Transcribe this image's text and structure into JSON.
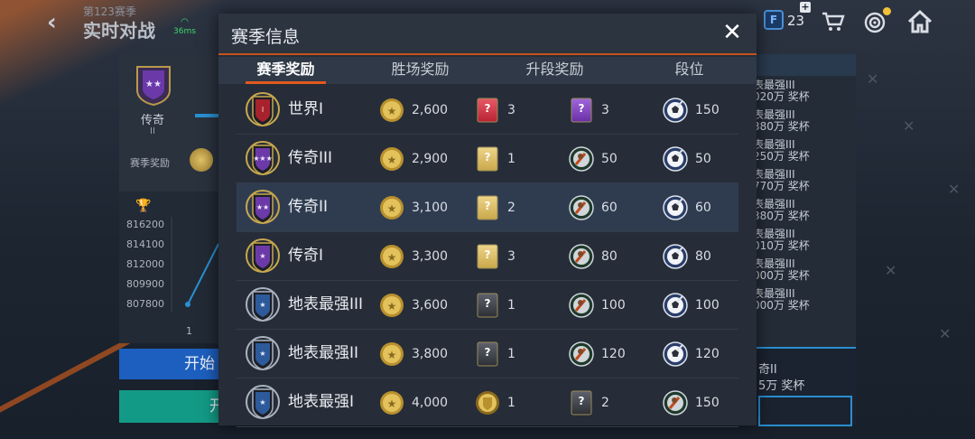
{
  "background": {
    "season_label": "第123赛季",
    "mode_title": "实时对战",
    "ping": "36ms",
    "fc_points": "23",
    "left_panel": {
      "rank_name": "传奇",
      "rank_sub": "II",
      "season_reward_label": "赛季奖励"
    },
    "graph": {
      "y_ticks": [
        "816200",
        "814100",
        "812000",
        "809900",
        "807800"
      ],
      "x_tick": "1"
    },
    "start_button_1": "开始",
    "start_button_2": "开",
    "right_panel": {
      "rows": [
        {
          "l1": "表最强III",
          "l2": "020万 奖杯"
        },
        {
          "l1": "表最强III",
          "l2": "380万 奖杯"
        },
        {
          "l1": "表最强III",
          "l2": "250万 奖杯"
        },
        {
          "l1": "表最强III",
          "l2": "770万 奖杯"
        },
        {
          "l1": "表最强III",
          "l2": "380万 奖杯"
        },
        {
          "l1": "表最强III",
          "l2": "010万 奖杯"
        },
        {
          "l1": "表最强III",
          "l2": "000万 奖杯"
        },
        {
          "l1": "表最强III",
          "l2": "000万 奖杯"
        }
      ],
      "bottom_line1": "奇II",
      "bottom_line2": "5万 奖杯"
    }
  },
  "modal": {
    "title": "赛季信息",
    "close_icon": "close-x",
    "tabs": [
      {
        "label": "赛季奖励",
        "active": true
      },
      {
        "label": "胜场奖励",
        "active": false
      },
      {
        "label": "升段奖励",
        "active": false
      },
      {
        "label": "段位",
        "active": false
      }
    ],
    "rows": [
      {
        "name": "世界I",
        "badge": "world",
        "coins": "2,600",
        "r1_icon": "red-pack",
        "r1": "3",
        "r2_icon": "purple-pack",
        "r2": "3",
        "r3_icon": "ball-token",
        "r3": "150",
        "current": false
      },
      {
        "name": "传奇III",
        "badge": "legend3",
        "coins": "2,900",
        "r1_icon": "gold-pack",
        "r1": "1",
        "r2_icon": "player-token",
        "r2": "50",
        "r3_icon": "ball-token",
        "r3": "50",
        "current": false
      },
      {
        "name": "传奇II",
        "badge": "legend2",
        "coins": "3,100",
        "r1_icon": "gold-pack",
        "r1": "2",
        "r2_icon": "player-token",
        "r2": "60",
        "r3_icon": "ball-token",
        "r3": "60",
        "current": true
      },
      {
        "name": "传奇I",
        "badge": "legend1",
        "coins": "3,300",
        "r1_icon": "gold-pack",
        "r1": "3",
        "r2_icon": "player-token",
        "r2": "80",
        "r3_icon": "ball-token",
        "r3": "80",
        "current": false
      },
      {
        "name": "地表最强III",
        "badge": "ultimate3",
        "coins": "3,600",
        "r1_icon": "black-pack",
        "r1": "1",
        "r2_icon": "player-token",
        "r2": "100",
        "r3_icon": "ball-token",
        "r3": "100",
        "current": false
      },
      {
        "name": "地表最强II",
        "badge": "ultimate2",
        "coins": "3,800",
        "r1_icon": "black-pack",
        "r1": "1",
        "r2_icon": "player-token",
        "r2": "120",
        "r3_icon": "ball-token",
        "r3": "120",
        "current": false
      },
      {
        "name": "地表最强I",
        "badge": "ultimate1",
        "coins": "4,000",
        "r1_icon": "gold-badge",
        "r1": "1",
        "r2_icon": "black-pack",
        "r2": "2",
        "r3_icon": "player-token",
        "r3": "150",
        "current": false
      }
    ]
  },
  "colors": {
    "accent_orange": "#e25a1f",
    "coin_gold": "#d8b445",
    "legend_purple": "#6b3aa8",
    "world_red": "#a8222e"
  }
}
